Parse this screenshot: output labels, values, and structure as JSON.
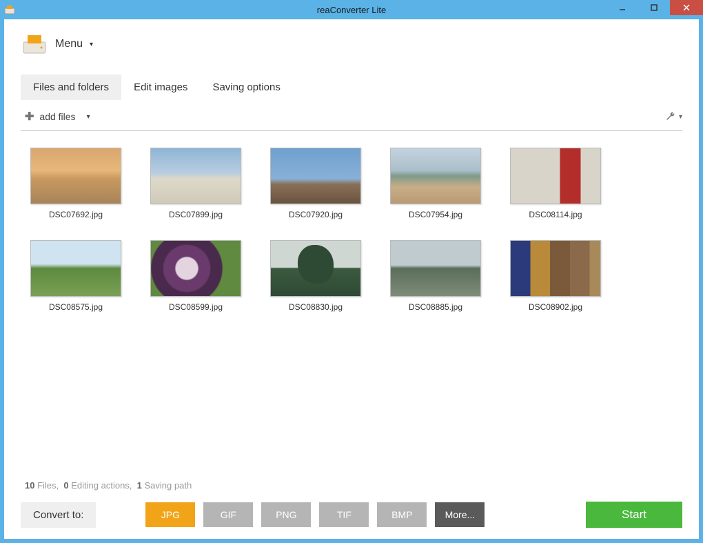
{
  "window": {
    "title": "reaConverter Lite"
  },
  "menu": {
    "label": "Menu"
  },
  "tabs": {
    "items": [
      {
        "label": "Files and folders",
        "active": true
      },
      {
        "label": "Edit images",
        "active": false
      },
      {
        "label": "Saving options",
        "active": false
      }
    ]
  },
  "toolbar": {
    "add_files_label": "add files"
  },
  "files": [
    {
      "name": "DSC07692.jpg",
      "thumb": "t0"
    },
    {
      "name": "DSC07899.jpg",
      "thumb": "t1"
    },
    {
      "name": "DSC07920.jpg",
      "thumb": "t2"
    },
    {
      "name": "DSC07954.jpg",
      "thumb": "t3"
    },
    {
      "name": "DSC08114.jpg",
      "thumb": "t4"
    },
    {
      "name": "DSC08575.jpg",
      "thumb": "t5"
    },
    {
      "name": "DSC08599.jpg",
      "thumb": "t6"
    },
    {
      "name": "DSC08830.jpg",
      "thumb": "t7"
    },
    {
      "name": "DSC08885.jpg",
      "thumb": "t8"
    },
    {
      "name": "DSC08902.jpg",
      "thumb": "t9"
    }
  ],
  "status": {
    "files_count": "10",
    "files_label": "Files,",
    "edit_count": "0",
    "edit_label": "Editing actions,",
    "save_count": "1",
    "save_label": "Saving path"
  },
  "convert": {
    "label": "Convert to:",
    "formats": [
      {
        "code": "JPG",
        "style": "fmt-jpg"
      },
      {
        "code": "GIF",
        "style": "fmt-grey"
      },
      {
        "code": "PNG",
        "style": "fmt-grey"
      },
      {
        "code": "TIF",
        "style": "fmt-grey"
      },
      {
        "code": "BMP",
        "style": "fmt-grey"
      },
      {
        "code": "More...",
        "style": "fmt-more"
      }
    ],
    "start_label": "Start"
  }
}
